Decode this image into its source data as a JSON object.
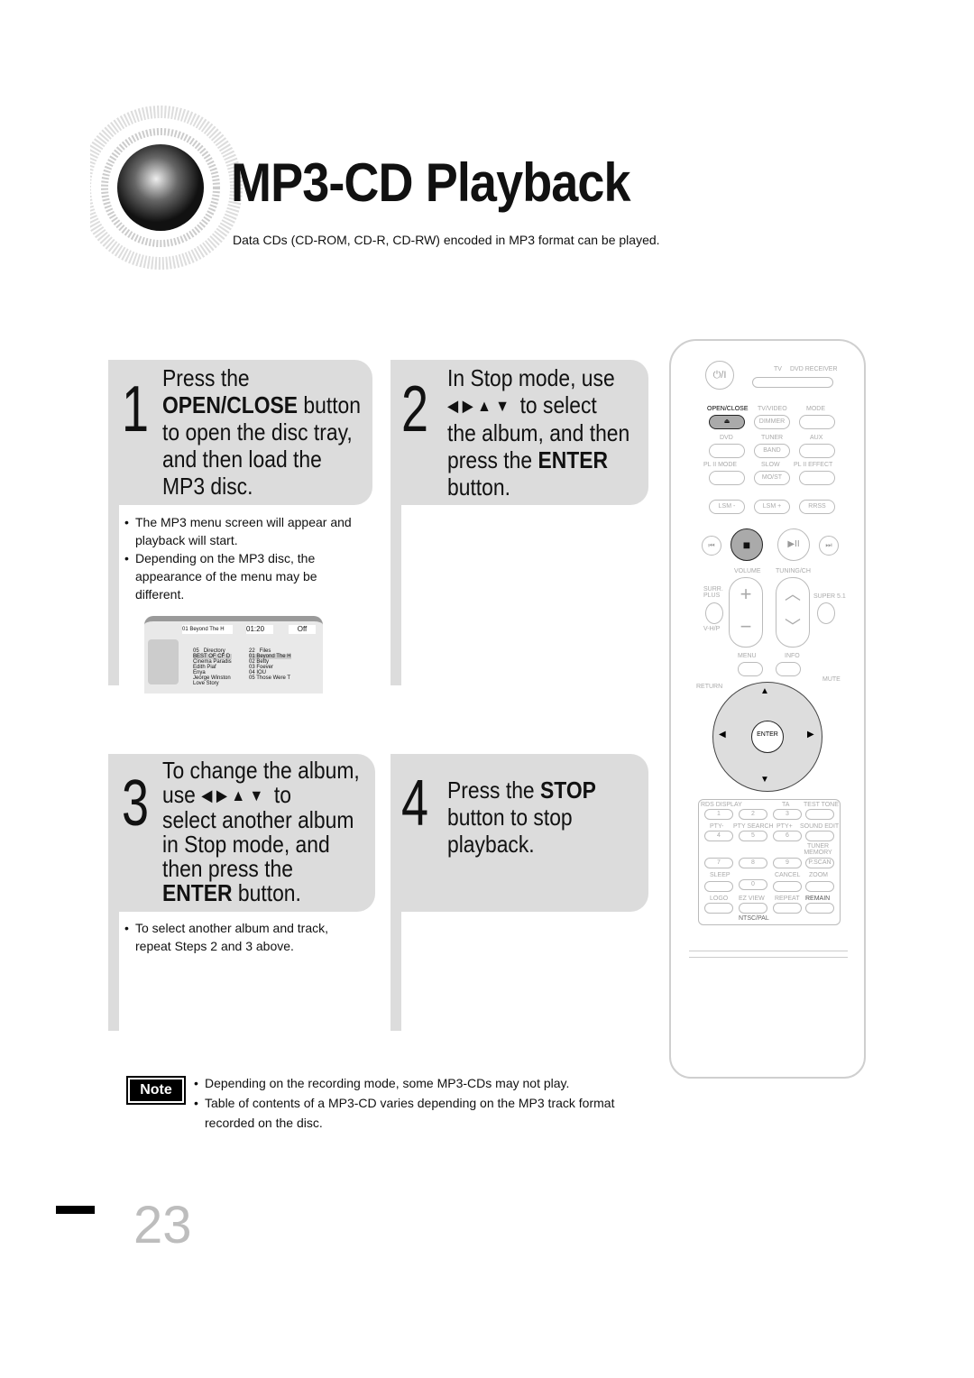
{
  "header": {
    "title": "MP3-CD Playback",
    "subtitle": "Data CDs (CD-ROM, CD-R, CD-RW) encoded in MP3 format can be played."
  },
  "steps": [
    {
      "number": "1",
      "lines": [
        "Press the",
        "OPEN/CLOSE button",
        "to open the disc tray,",
        "and then load the",
        "MP3 disc."
      ],
      "bullets": [
        "The MP3 menu screen will appear and playback will start.",
        "Depending on the MP3 disc, the appearance of the menu may be different."
      ]
    },
    {
      "number": "2",
      "lines": [
        "In Stop mode, use",
        "to select",
        "the album, and then",
        "press the ENTER",
        "button."
      ]
    },
    {
      "number": "3",
      "lines": [
        "To change the album,",
        "use",
        "to",
        "select another album",
        "in Stop mode, and",
        "then press the",
        "ENTER button."
      ],
      "bullets": [
        "To select another album and track, repeat Steps 2 and 3 above."
      ]
    },
    {
      "number": "4",
      "lines": [
        "Press the STOP",
        "button to stop",
        "playback."
      ]
    }
  ],
  "arrows": "◀ ▶ ▲ ▼",
  "menu_screen": {
    "track": "01 Beyond The H",
    "time": "01:20",
    "repeat": "Off",
    "dir_count": "05",
    "dir_label": "Directory",
    "file_count": "22",
    "file_label": "Files",
    "directories": [
      "BEST OF CF D",
      "Cinema Paradis",
      "Edith Piaf",
      "Enya",
      "Jeorge Winston",
      "Love Story"
    ],
    "files": [
      "01 Beyond The H",
      "02 Betty",
      "03 Foever",
      "04 IOU",
      "05 Those Were T"
    ]
  },
  "remote": {
    "power": "⏻/I",
    "tv": "TV",
    "dvd_receiver": "DVD RECEIVER",
    "open_close": "OPEN/CLOSE",
    "tv_video": "TV/VIDEO",
    "dimmer": "DIMMER",
    "mode": "MODE",
    "dvd": "DVD",
    "tuner": "TUNER",
    "band": "BAND",
    "aux": "AUX",
    "pl2_mode": "PL II MODE",
    "slow": "SLOW",
    "mo_st": "MO/ST",
    "pl2_effect": "PL II EFFECT",
    "lsm_minus": "LSM -",
    "lsm_plus": "LSM +",
    "rrss": "RRSS",
    "volume": "VOLUME",
    "tuning_ch": "TUNING/CH",
    "surr_plus": "SURR. PLUS",
    "vhp": "V-H/P",
    "super51": "SUPER 5.1",
    "menu": "MENU",
    "info": "INFO",
    "return": "RETURN",
    "mute": "MUTE",
    "enter": "ENTER",
    "rds_display": "RDS DISPLAY",
    "ta": "TA",
    "test_tone": "TEST TONE",
    "pty_minus": "PTY-",
    "pty_search": "PTY SEARCH",
    "pty_plus": "PTY+",
    "sound_edit": "SOUND EDIT",
    "tuner_memory": "TUNER MEMORY",
    "pscan": "P.SCAN",
    "sleep": "SLEEP",
    "cancel": "CANCEL",
    "zoom": "ZOOM",
    "logo": "LOGO",
    "ez_view": "EZ VIEW",
    "repeat": "REPEAT",
    "remain": "REMAIN",
    "ntsc_pal": "NTSC/PAL",
    "digits": [
      "1",
      "2",
      "3",
      "4",
      "5",
      "6",
      "7",
      "8",
      "9",
      "0"
    ]
  },
  "note": {
    "label": "Note",
    "items": [
      "Depending on the recording mode, some MP3-CDs may not play.",
      "Table of contents of a MP3-CD varies depending on the MP3 track format recorded on the disc."
    ]
  },
  "page_number": "23"
}
